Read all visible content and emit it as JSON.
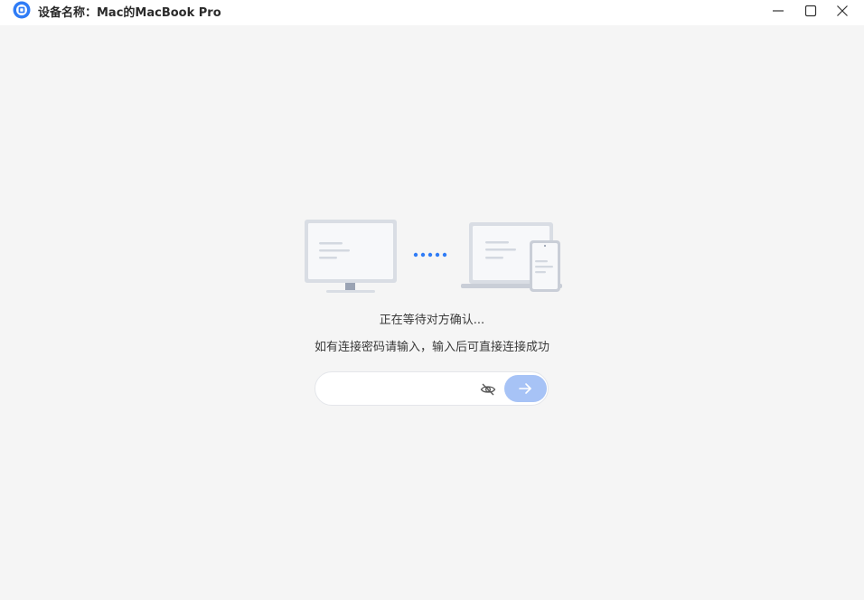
{
  "window": {
    "title": "设备名称：Mac的MacBook Pro",
    "controls": [
      "minimize-icon",
      "maximize-icon",
      "close-icon"
    ]
  },
  "main": {
    "status": "正在等待对方确认...",
    "hint": "如有连接密码请输入，输入后可直接连接成功",
    "password_input": {
      "value": "",
      "placeholder": ""
    },
    "visibility_toggle_icon": "eye-slash-icon",
    "submit_icon": "arrow-right-icon"
  },
  "colors": {
    "accent": "#2f7cf6",
    "submit_button": "#a7c3f6",
    "background": "#f5f5f5",
    "titlebar": "#ffffff"
  }
}
